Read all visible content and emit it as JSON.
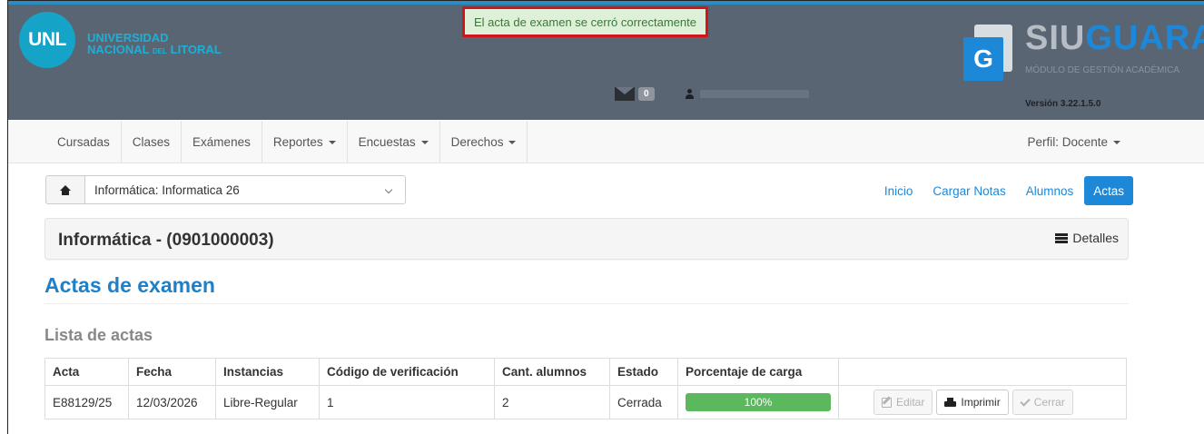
{
  "header": {
    "logo_text": "UNL",
    "university_line1": "UNIVERSIDAD",
    "university_line2_a": "NACIONAL",
    "university_line2_small": "DEL",
    "university_line2_b": "LITORAL",
    "flash_message": "El acta de examen se cerró correctamente",
    "mail_count": "0",
    "brand_part1": "SIU",
    "brand_part2": "GUARANI",
    "brand_subtitle": "MÓDULO DE GESTIÓN ACADÉMICA",
    "version": "Versión 3.22.1.5.0",
    "logo_letter": "G"
  },
  "nav": {
    "items": [
      {
        "label": "Cursadas"
      },
      {
        "label": "Clases"
      },
      {
        "label": "Exámenes"
      },
      {
        "label": "Reportes"
      },
      {
        "label": "Encuestas"
      },
      {
        "label": "Derechos"
      }
    ],
    "profile": "Perfil: Docente"
  },
  "toolbar": {
    "combo_value": "Informática: Informatica 26",
    "tabs": [
      {
        "label": "Inicio"
      },
      {
        "label": "Cargar Notas"
      },
      {
        "label": "Alumnos"
      },
      {
        "label": "Actas"
      }
    ]
  },
  "course": {
    "title": "Informática - (0901000003)",
    "details_label": "Detalles"
  },
  "page": {
    "title": "Actas de examen",
    "subtitle": "Lista de actas"
  },
  "table": {
    "headers": [
      "Acta",
      "Fecha",
      "Instancias",
      "Código de verificación",
      "Cant. alumnos",
      "Estado",
      "Porcentaje de carga",
      ""
    ],
    "rows": [
      {
        "acta": "E88129/25",
        "fecha": "12/03/2026",
        "instancias": "Libre-Regular",
        "codigo": "1",
        "cantidad": "2",
        "estado": "Cerrada",
        "porcentaje": "100%",
        "porcentaje_value": 100,
        "btn_editar": "Editar",
        "btn_imprimir": "Imprimir",
        "btn_cerrar": "Cerrar"
      }
    ]
  },
  "colors": {
    "accent": "#1e88d8",
    "header_bg": "#5a6573",
    "flash_border": "#d0151b",
    "progress": "#5cb85c"
  }
}
